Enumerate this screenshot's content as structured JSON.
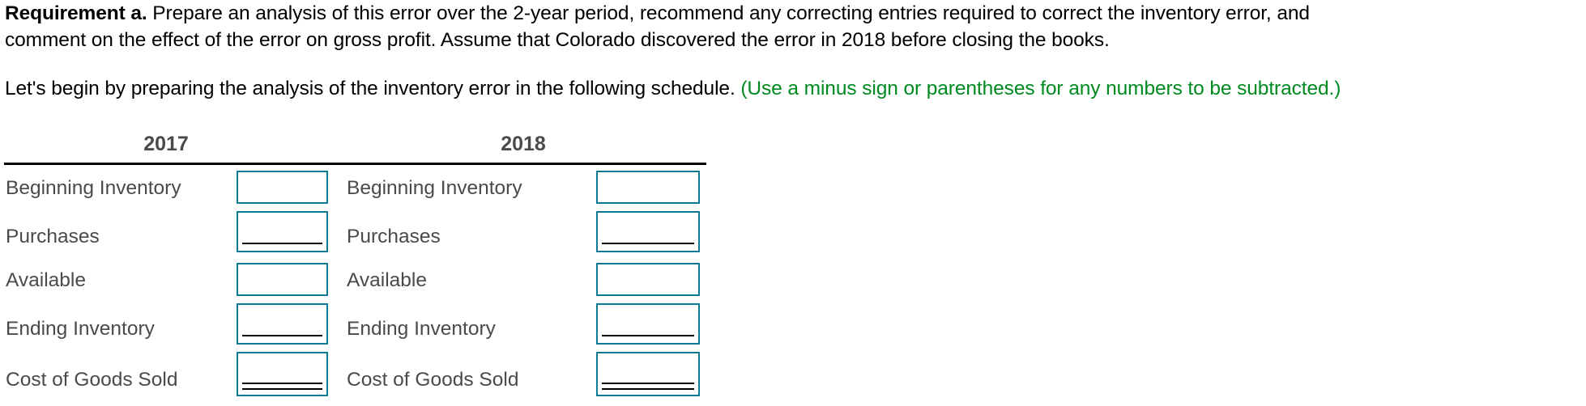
{
  "instructions": {
    "requirement_label": "Requirement a.",
    "requirement_text_line1": " Prepare an analysis of this error over the 2-year period, recommend any correcting entries required to correct the inventory error, and",
    "requirement_text_line2": "comment on the effect of the error on gross profit. Assume that Colorado discovered the error in 2018 before closing the books.",
    "lead_text": "Let's begin by preparing the analysis of the inventory error in the following schedule. ",
    "hint_text": "(Use a minus sign or parentheses for any numbers to be subtracted.)"
  },
  "colors": {
    "hint": "#008a1f",
    "input_border": "#0d7a96",
    "label_text": "#4a4a4a"
  },
  "schedule": {
    "columns": [
      {
        "year": "2017",
        "rows": [
          {
            "label": "Beginning Inventory",
            "value": "",
            "underline": "none"
          },
          {
            "label": "Purchases",
            "value": "",
            "underline": "single"
          },
          {
            "label": "Available",
            "value": "",
            "underline": "none"
          },
          {
            "label": "Ending Inventory",
            "value": "",
            "underline": "single"
          },
          {
            "label": "Cost of Goods Sold",
            "value": "",
            "underline": "double"
          }
        ]
      },
      {
        "year": "2018",
        "rows": [
          {
            "label": "Beginning Inventory",
            "value": "",
            "underline": "none"
          },
          {
            "label": "Purchases",
            "value": "",
            "underline": "single"
          },
          {
            "label": "Available",
            "value": "",
            "underline": "none"
          },
          {
            "label": "Ending Inventory",
            "value": "",
            "underline": "single"
          },
          {
            "label": "Cost of Goods Sold",
            "value": "",
            "underline": "double"
          }
        ]
      }
    ]
  }
}
